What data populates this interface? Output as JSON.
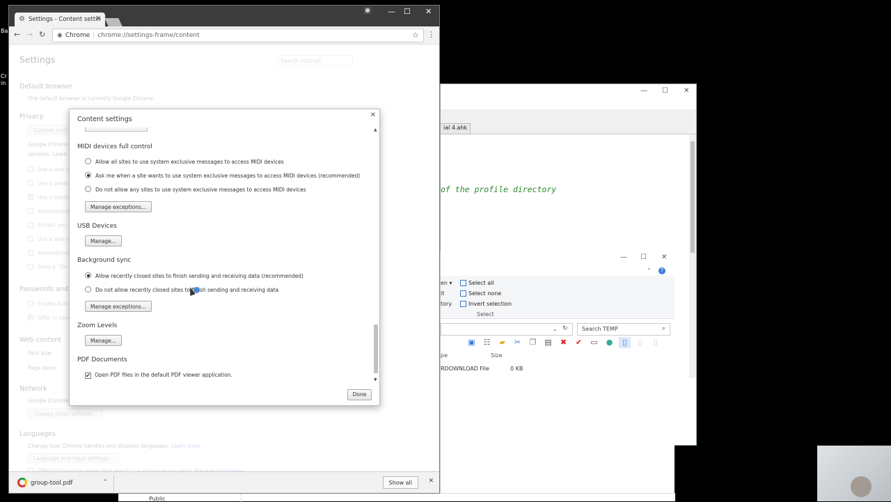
{
  "desktop": {
    "left_texts": [
      "Ba",
      "Cr",
      "in"
    ]
  },
  "editor": {
    "tab": "ial 4.ahk",
    "code": "of the profile directory",
    "controls": [
      "—",
      "☐",
      "✕"
    ]
  },
  "explorer": {
    "controls": [
      "—",
      "☐",
      "✕"
    ],
    "left_cut": [
      "en ▾",
      "it",
      "tory"
    ],
    "select_items": [
      "Select all",
      "Select none",
      "Invert selection"
    ],
    "group_label": "Select",
    "search": "Search TEMP",
    "columns": {
      "type": "pe",
      "size": "Size"
    },
    "row": {
      "type": "RDOWNLOAD File",
      "size": "0 KB"
    },
    "bottom_item": "Public"
  },
  "chrome": {
    "tab_title": "Settings - Content settin",
    "omnibox": {
      "chip": "Chrome",
      "url": "chrome://settings-frame/content"
    },
    "window_controls": [
      "—",
      "☐",
      "✕"
    ]
  },
  "settings": {
    "title": "Settings",
    "search_placeholder": "Search settings",
    "default_browser": {
      "heading": "Default browser",
      "text": "The default browser is currently Google Chrome."
    },
    "privacy": {
      "heading": "Privacy",
      "button": "Content settin",
      "text1": "Google Chrome",
      "text2": "services. Learn m",
      "checks": [
        "Use a web se",
        "Use a predic",
        "Use a predic",
        "Automaticall",
        "Protect you",
        "Use a web se",
        "Automaticall",
        "Send a \"Do N"
      ]
    },
    "passwords": {
      "heading": "Passwords and fo",
      "checks": [
        "Enable Autof",
        "Offer to save"
      ]
    },
    "web_content": {
      "heading": "Web content",
      "font_size": "Font size:",
      "page_zoom": "Page zoom:"
    },
    "network": {
      "heading": "Network",
      "text": "Google Chrome",
      "button": "Change proxy settings..."
    },
    "languages": {
      "heading": "Languages",
      "text": "Change how Chrome handles and displays languages.",
      "link": "Learn more",
      "button": "Language and input settings...",
      "check": "Offer to translate pages that aren't in a language you read.",
      "check_link": "Manage languages"
    }
  },
  "dialog": {
    "title": "Content settings",
    "midi": {
      "heading": "MIDI devices full control",
      "options": [
        "Allow all sites to use system exclusive messages to access MIDI devices",
        "Ask me when a site wants to use system exclusive messages to access MIDI devices (recommended)",
        "Do not allow any sites to use system exclusive messages to access MIDI devices"
      ],
      "selected": 1,
      "button": "Manage exceptions..."
    },
    "usb": {
      "heading": "USB Devices",
      "button": "Manage..."
    },
    "background_sync": {
      "heading": "Background sync",
      "options": [
        "Allow recently closed sites to finish sending and receiving data (recommended)",
        "Do not allow recently closed sites to finish sending and receiving data"
      ],
      "selected": 0,
      "button": "Manage exceptions..."
    },
    "zoom": {
      "heading": "Zoom Levels",
      "button": "Manage..."
    },
    "pdf": {
      "heading": "PDF Documents",
      "option": "Open PDF files in the default PDF viewer application.",
      "checked": true
    },
    "done": "Done"
  },
  "download_bar": {
    "file": "group-tool.pdf",
    "show_all": "Show all"
  }
}
